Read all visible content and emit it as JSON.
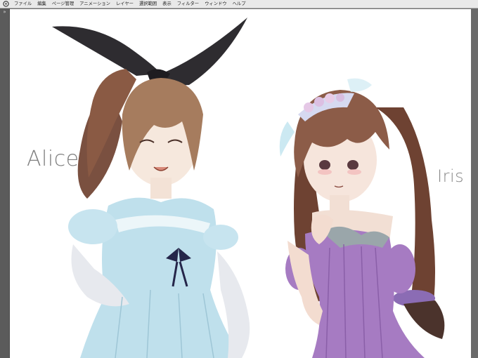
{
  "menu": {
    "items": [
      "ファイル",
      "編集",
      "ページ管理",
      "アニメーション",
      "レイヤー",
      "選択範囲",
      "表示",
      "フィルター",
      "ウィンドウ",
      "ヘルプ"
    ]
  },
  "toolbar": {
    "collapse_glyph": "»"
  },
  "artwork": {
    "left_character_name": "Alice",
    "right_character_name": "Iris"
  }
}
